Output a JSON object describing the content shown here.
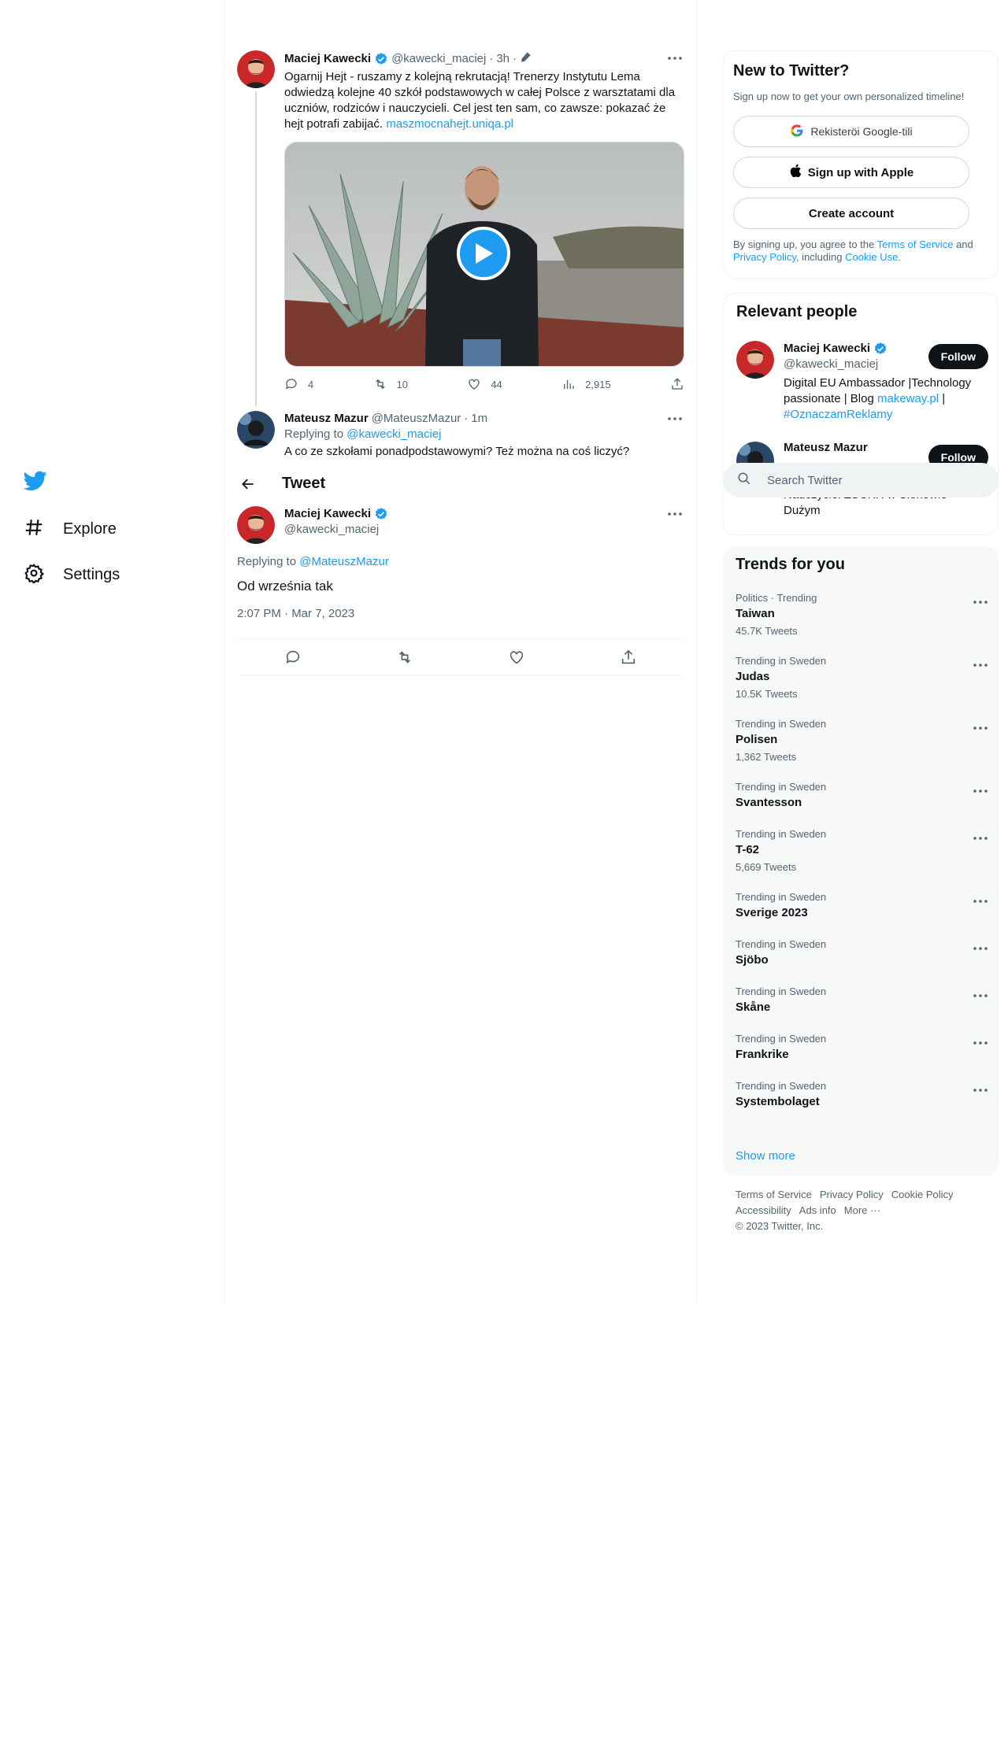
{
  "nav": {
    "explore_label": "Explore",
    "settings_label": "Settings"
  },
  "thread": {
    "header_title": "Tweet",
    "original": {
      "name": "Maciej Kawecki",
      "handle": "@kawecki_maciej",
      "separator": "·",
      "time": "3h",
      "text": "Ogarnij Hejt - ruszamy z kolejną rekrutacją! Trenerzy Instytutu Lema odwiedzą kolejne 40 szkół podstawowych w całej Polsce z warsztatami dla uczniów, rodziców i nauczycieli. Cel jest ten sam, co zawsze: pokazać że hejt potrafi zabijać.",
      "link": "maszmocnahejt.uniqa.pl",
      "stats": {
        "replies": "4",
        "retweets": "10",
        "likes": "44",
        "views": "2,915"
      }
    },
    "reply": {
      "name": "Mateusz Mazur",
      "handle": "@MateuszMazur",
      "separator": "·",
      "time": "1m",
      "replying_prefix": "Replying to",
      "replying_to": "@kawecki_maciej",
      "text": "A co ze szkołami ponadpodstawowymi? Też można na coś liczyć?"
    },
    "focused": {
      "name": "Maciej Kawecki",
      "handle": "@kawecki_maciej",
      "replying_prefix": "Replying to",
      "replying_to": "@MateuszMazur",
      "text": "Od września tak",
      "timestamp": "2:07 PM · Mar 7, 2023"
    }
  },
  "signup": {
    "title": "New to Twitter?",
    "subtitle": "Sign up now to get your own personalized timeline!",
    "google_label": "Rekisteröi Google-tili",
    "apple_label": "Sign up with Apple",
    "create_label": "Create account",
    "terms_prefix": "By signing up, you agree to the",
    "terms_link": "Terms of Service",
    "terms_and": "and",
    "privacy_link": "Privacy Policy",
    "including": ", including",
    "cookie_link": "Cookie Use."
  },
  "relevant": {
    "title": "Relevant people",
    "people": [
      {
        "name": "Maciej Kawecki",
        "handle": "@kawecki_maciej",
        "bio_text": "Digital EU Ambassador |Technology passionate | Blog",
        "bio_link": "makeway.pl",
        "bio_sep": "|",
        "bio_hashtag": "#OznaczamReklamy",
        "follow_label": "Follow"
      },
      {
        "name": "Mateusz Mazur",
        "bio_tail": "Nauczyciel ZSCKR w Siehowie Dużym",
        "follow_label": "Follow"
      }
    ]
  },
  "search": {
    "placeholder": "Search Twitter"
  },
  "trends": {
    "title": "Trends for you",
    "items": [
      {
        "context": "Politics · Trending",
        "name": "Taiwan",
        "count": "45.7K Tweets"
      },
      {
        "context": "Trending in Sweden",
        "name": "Judas",
        "count": "10.5K Tweets"
      },
      {
        "context": "Trending in Sweden",
        "name": "Polisen",
        "count": "1,362 Tweets"
      },
      {
        "context": "Trending in Sweden",
        "name": "Svantesson",
        "count": ""
      },
      {
        "context": "Trending in Sweden",
        "name": "T-62",
        "count": "5,669 Tweets"
      },
      {
        "context": "Trending in Sweden",
        "name": "Sverige 2023",
        "count": ""
      },
      {
        "context": "Trending in Sweden",
        "name": "Sjöbo",
        "count": ""
      },
      {
        "context": "Trending in Sweden",
        "name": "Skåne",
        "count": ""
      },
      {
        "context": "Trending in Sweden",
        "name": "Frankrike",
        "count": ""
      },
      {
        "context": "Trending in Sweden",
        "name": "Systembolaget",
        "count": ""
      }
    ],
    "show_more": "Show more"
  },
  "footer": {
    "links": [
      "Terms of Service",
      "Privacy Policy",
      "Cookie Policy",
      "Accessibility",
      "Ads info",
      "More ···"
    ],
    "copyright": "© 2023 Twitter, Inc."
  },
  "colors": {
    "accent": "#1d9bf0",
    "text": "#0f1419",
    "secondary": "#536471"
  }
}
